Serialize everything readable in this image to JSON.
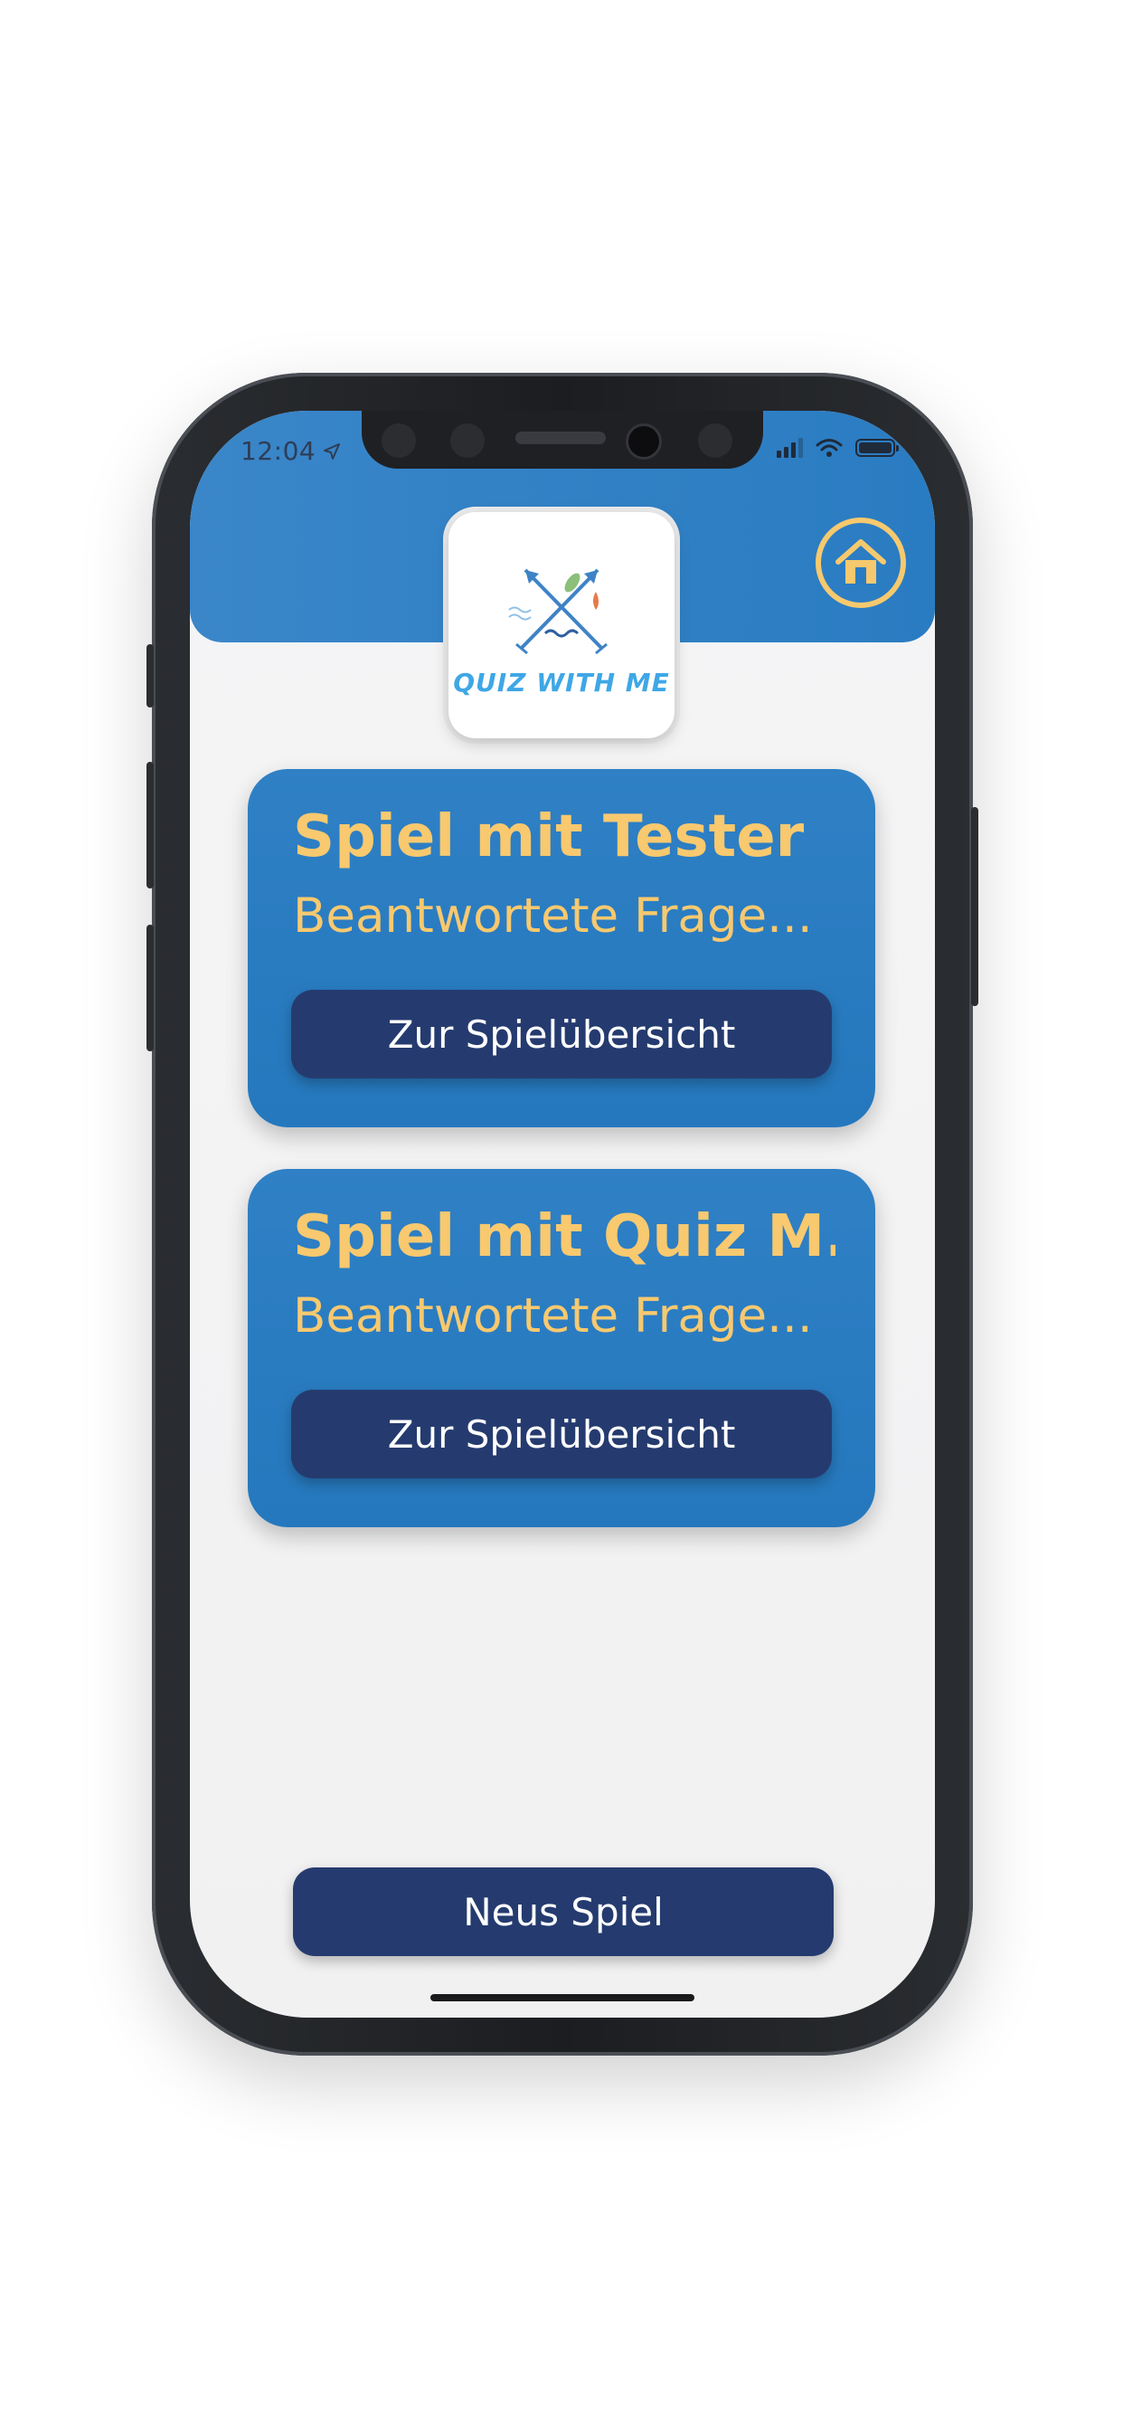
{
  "status_bar": {
    "time": "12:04",
    "location_icon": "location-arrow-icon",
    "signal_icon": "cellular-signal-icon",
    "wifi_icon": "wifi-icon",
    "battery_icon": "battery-icon"
  },
  "header": {
    "logo_text": "QUIZ WITH ME",
    "home_icon": "home-icon"
  },
  "games": [
    {
      "title": "Spiel mit Tester",
      "subtitle": "Beantwortete Frage...",
      "button_label": "Zur Spielübersicht"
    },
    {
      "title": "Spiel mit Quiz M...",
      "subtitle": "Beantwortete Frage...",
      "button_label": "Zur Spielübersicht"
    }
  ],
  "new_game_label": "Neus Spiel",
  "colors": {
    "header_blue": "#2a7cc2",
    "card_blue": "#2f80c5",
    "accent_yellow": "#f8c96f",
    "button_navy": "#253b6f"
  }
}
